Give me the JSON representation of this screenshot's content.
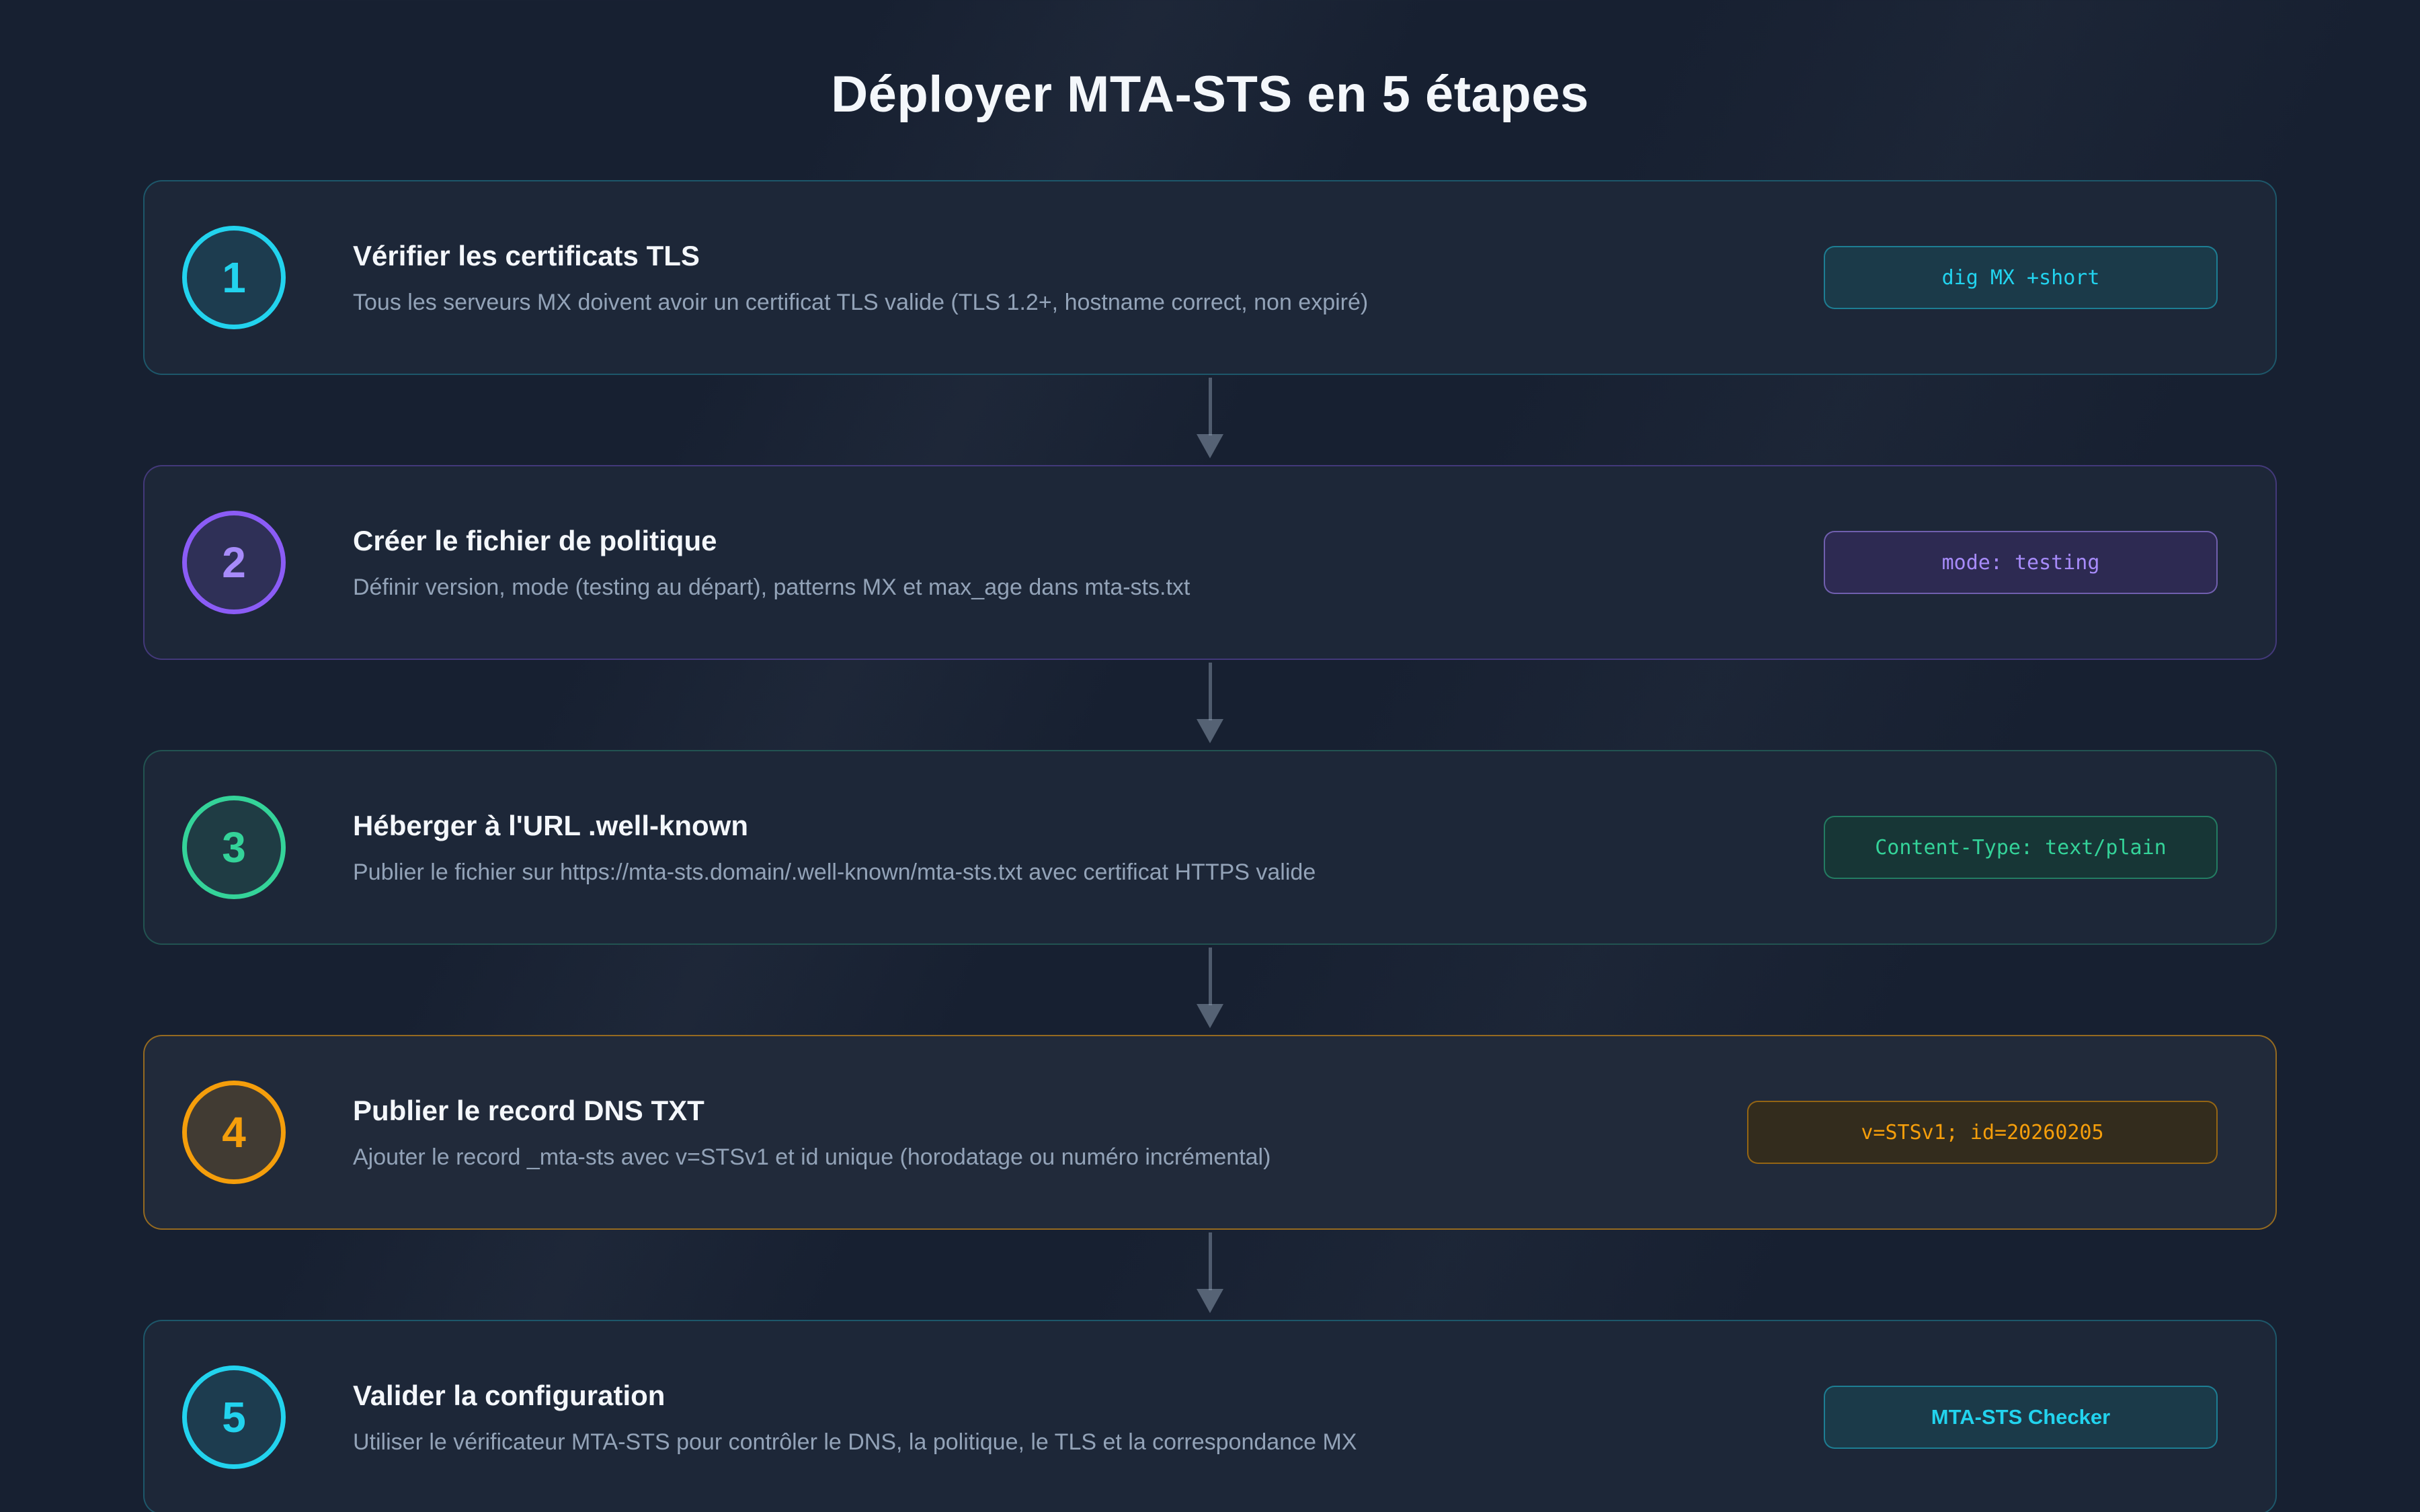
{
  "page": {
    "title": "Déployer MTA-STS en 5 étapes",
    "background_color": "#172031"
  },
  "steps": [
    {
      "number": "1",
      "title": "Vérifier les certificats TLS",
      "description": "Tous les serveurs MX doivent avoir un certificat TLS valide (TLS 1.2+, hostname correct, non expiré)",
      "chip": "dig MX +short",
      "accent_color": "#22d3ee"
    },
    {
      "number": "2",
      "title": "Créer le fichier de politique",
      "description": "Définir version, mode (testing au départ), patterns MX et max_age dans mta-sts.txt",
      "chip": "mode: testing",
      "accent_color": "#8b5cf6"
    },
    {
      "number": "3",
      "title": "Héberger à l'URL .well-known",
      "description": "Publier le fichier sur https://mta-sts.domain/.well-known/mta-sts.txt avec certificat HTTPS valide",
      "chip": "Content-Type: text/plain",
      "accent_color": "#34d399"
    },
    {
      "number": "4",
      "title": "Publier le record DNS TXT",
      "description": "Ajouter le record _mta-sts avec v=STSv1 et id unique (horodatage ou numéro incrémental)",
      "chip": "v=STSv1; id=20260205",
      "accent_color": "#f59e0b",
      "highlighted": true
    },
    {
      "number": "5",
      "title": "Valider la configuration",
      "description": "Utiliser le vérificateur MTA-STS pour contrôler le DNS, la politique, le TLS et la correspondance MX",
      "chip": "MTA-STS Checker",
      "accent_color": "#22d3ee"
    }
  ]
}
